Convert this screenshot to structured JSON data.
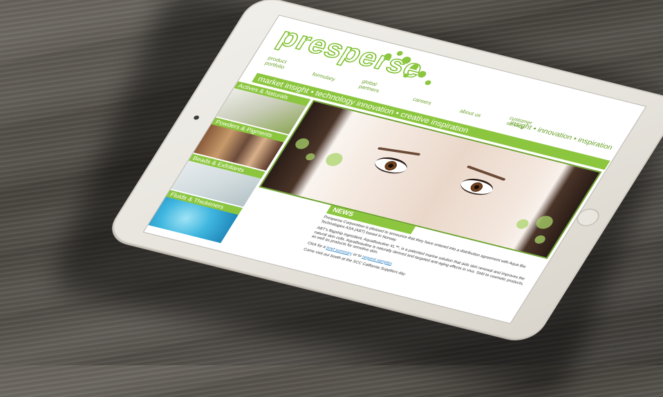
{
  "site": {
    "logo_text": "presperse",
    "nav": [
      {
        "label": "product portfolio"
      },
      {
        "label": "formulary"
      },
      {
        "label": "global partners"
      },
      {
        "label": "careers"
      },
      {
        "label": "about us"
      },
      {
        "label": "customer service"
      }
    ],
    "tagline_right": "insight • innovation • inspiration",
    "hero_banner": "market insight • technology innovation • creative inspiration",
    "tiles": [
      {
        "label": "Actives & Naturals"
      },
      {
        "label": "Beads & Exfoliants"
      },
      {
        "label": "Powders & Pigments"
      },
      {
        "label": "Fluids & Thickeners"
      }
    ],
    "news": {
      "title": "NEWS",
      "p1": "Presperse Corporation is pleased to announce that they have entered into a distribution agreement with Aqua Bio Technologies ASA (ABT) based in Norway.",
      "p2": "ABT's flagship ingredient, AquaBeautine XL™, is a patented marine solution that aids skin renewal and improves the natural skin cells. AquaBeautine is naturally derived and targeted anti-aging effects in vivo. Sold to cosmetic products, as well as products for sensitive skin.",
      "p3_prefix": "Click for a",
      "link1": "brief summary",
      "p3_mid": "or to",
      "link2": "request samples",
      "p4": "Come visit our booth at the SCC California Suppliers day"
    }
  },
  "colors": {
    "brand_green": "#8cc63f",
    "dark_green": "#6aa12a",
    "link_blue": "#2a7fc1"
  }
}
